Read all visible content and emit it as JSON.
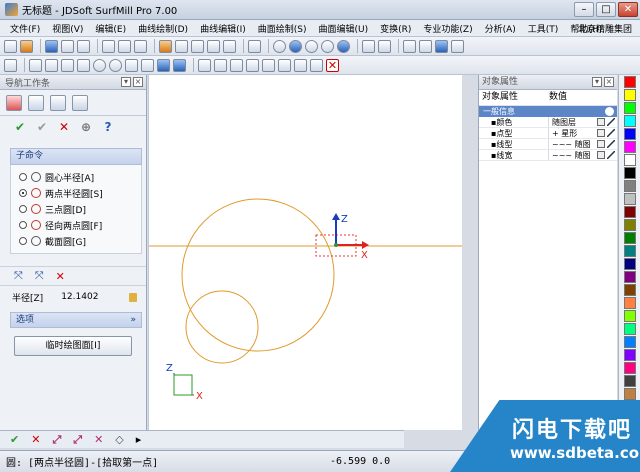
{
  "window": {
    "title": "无标题 - JDSoft SurfMill Pro 7.00",
    "min": "–",
    "max": "□",
    "close": "✕"
  },
  "menu": {
    "items": [
      "文件(F)",
      "视图(V)",
      "编辑(E)",
      "曲线绘制(D)",
      "曲线编辑(I)",
      "曲面绘制(S)",
      "曲面编辑(U)",
      "变换(R)",
      "专业功能(Z)",
      "分析(A)",
      "工具(T)",
      "帮助(H)"
    ],
    "company": "北京精雕集团"
  },
  "nav_panel": {
    "title": "导航工作条",
    "sub_title": "子命令",
    "options": [
      "圆心半径[A]",
      "两点半径圆[S]",
      "三点圆[D]",
      "径向两点圆[F]",
      "截面圆[G]"
    ],
    "selected_index": 1,
    "radius_label": "半径[Z]",
    "radius_value": "12.1402",
    "options_title": "选项",
    "temp_button": "临时绘图面[I]"
  },
  "props_panel": {
    "title": "对象属性",
    "col_attr": "对象属性",
    "col_value": "数值",
    "group": "一般信息",
    "rows": [
      {
        "key": "▪颜色",
        "value": "随图层"
      },
      {
        "key": "▪点型",
        "value": "+ 星形"
      },
      {
        "key": "▪线型",
        "value": "~~~ 随图"
      },
      {
        "key": "▪线宽",
        "value": "~~~ 随图"
      }
    ]
  },
  "canvas": {
    "axis_z": "Z",
    "axis_x": "X"
  },
  "status": {
    "prompt": "圆: [两点半径圆]-[拾取第一点]",
    "coords": "-6.599 0.0"
  },
  "watermark": {
    "line1": "闪电下载吧",
    "line2": "www.sdbeta.com"
  },
  "swatch_colors": [
    "#ff0000",
    "#ffff00",
    "#00ff00",
    "#00ffff",
    "#0000ff",
    "#ff00ff",
    "#ffffff",
    "#000000",
    "#808080",
    "#c0c0c0",
    "#800000",
    "#808000",
    "#008000",
    "#008080",
    "#000080",
    "#800080",
    "#804000",
    "#ff8040",
    "#80ff00",
    "#00ff80",
    "#0080ff",
    "#8000ff",
    "#ff0080",
    "#404040",
    "#c08040",
    "#408080"
  ]
}
